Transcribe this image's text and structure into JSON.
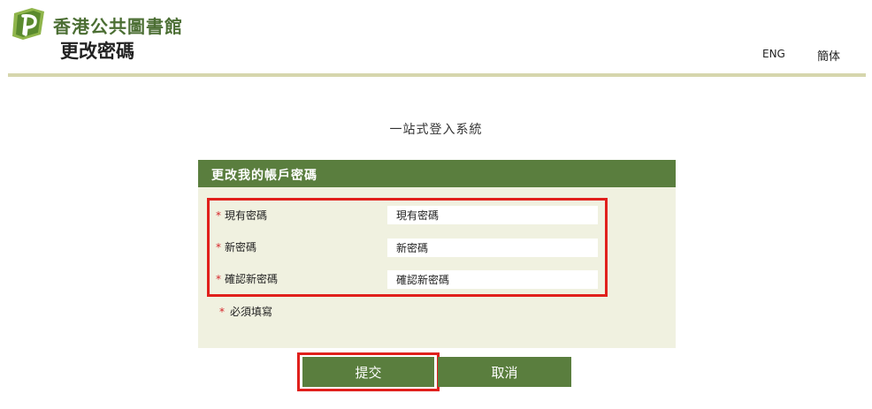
{
  "header": {
    "org_name": "香港公共圖書館",
    "page_title": "更改密碼",
    "lang_eng": "ENG",
    "lang_sc": "簡体"
  },
  "system_name": "一站式登入系統",
  "form": {
    "title": "更改我的帳戶密碼",
    "required_mark": "*",
    "fields": [
      {
        "label": "現有密碼",
        "placeholder": "現有密碼"
      },
      {
        "label": "新密碼",
        "placeholder": "新密碼"
      },
      {
        "label": "確認新密碼",
        "placeholder": "確認新密碼"
      }
    ],
    "required_note": "必須填寫",
    "submit_label": "提交",
    "cancel_label": "取消"
  },
  "colors": {
    "brand_green": "#5a7e3e",
    "panel_bg": "#f0f1e0",
    "header_rule": "#d6d6ad",
    "highlight_red": "#e0201c",
    "required_red": "#d6252a"
  },
  "icons": {
    "logo": "hkpl-logo-icon"
  }
}
